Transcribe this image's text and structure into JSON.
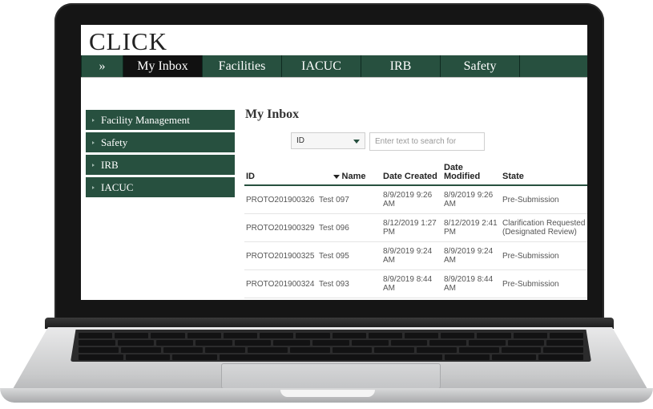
{
  "app": {
    "logo": "CLICK"
  },
  "nav": {
    "expand_glyph": "»",
    "items": [
      {
        "label": "My Inbox",
        "active": true
      },
      {
        "label": "Facilities"
      },
      {
        "label": "IACUC"
      },
      {
        "label": "IRB"
      },
      {
        "label": "Safety"
      }
    ]
  },
  "sidebar": {
    "items": [
      {
        "label": "Facility Management"
      },
      {
        "label": "Safety"
      },
      {
        "label": "IRB"
      },
      {
        "label": "IACUC"
      }
    ]
  },
  "main": {
    "title": "My Inbox",
    "filter": {
      "selected": "ID"
    },
    "search": {
      "placeholder": "Enter text to search for"
    },
    "table": {
      "headers": {
        "id": "ID",
        "name": "Name",
        "date_created": "Date Created",
        "date_modified": "Date Modified",
        "state": "State"
      },
      "rows": [
        {
          "id": "PROTO201900326",
          "name": "Test 097",
          "date_created": "8/9/2019 9:26 AM",
          "date_modified": "8/9/2019 9:26 AM",
          "state": "Pre-Submission"
        },
        {
          "id": "PROTO201900329",
          "name": "Test 096",
          "date_created": "8/12/2019 1:27 PM",
          "date_modified": "8/12/2019 2:41 PM",
          "state": "Clarification Requested (Designated Review)"
        },
        {
          "id": "PROTO201900325",
          "name": "Test 095",
          "date_created": "8/9/2019 9:24 AM",
          "date_modified": "8/9/2019 9:24 AM",
          "state": "Pre-Submission"
        },
        {
          "id": "PROTO201900324",
          "name": "Test 093",
          "date_created": "8/9/2019 8:44 AM",
          "date_modified": "8/9/2019 8:44 AM",
          "state": "Pre-Submission"
        }
      ]
    }
  },
  "colors": {
    "brand_green": "#27503f",
    "active_nav": "#111111"
  },
  "icons": {
    "sort": "sort-down-icon",
    "dropdown": "chevron-down-icon"
  }
}
